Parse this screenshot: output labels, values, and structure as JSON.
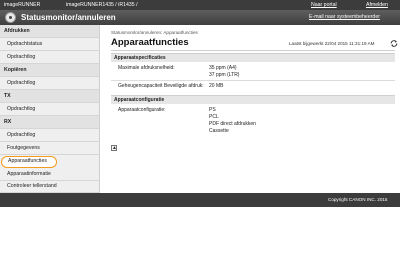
{
  "topbar": {
    "brand": "imageRUNNER",
    "model": "imageRUNNER1435 / iR1435 /",
    "portal_link": "Naar portal",
    "logout_link": "Afmelden"
  },
  "header": {
    "title": "Statusmonitor/annuleren",
    "mail_link": "E-mail naar systeembeheerder"
  },
  "sidebar": {
    "items": [
      {
        "label": "Afdrukken",
        "kind": "head"
      },
      {
        "label": "Opdrachtstatus",
        "kind": "link"
      },
      {
        "label": "Opdrachtlog",
        "kind": "link"
      },
      {
        "label": "Kopiëren",
        "kind": "head"
      },
      {
        "label": "Opdrachtlog",
        "kind": "link"
      },
      {
        "label": "TX",
        "kind": "head"
      },
      {
        "label": "Opdrachtlog",
        "kind": "link"
      },
      {
        "label": "RX",
        "kind": "head"
      },
      {
        "label": "Opdrachtlog",
        "kind": "link"
      },
      {
        "label": "Foutgegevens",
        "kind": "link"
      },
      {
        "label": "Apparaatfuncties",
        "kind": "selected"
      },
      {
        "label": "Apparaatinformatie",
        "kind": "link"
      },
      {
        "label": "Controleer tellerstand",
        "kind": "link"
      }
    ]
  },
  "main": {
    "breadcrumb": "Statusmonitor/annuleren: Apparaatfuncties",
    "title": "Apparaatfuncties",
    "last_updated": "Laatst bijgewerkt 22/04 2015 11:31:19 AM",
    "sections": [
      {
        "title": "Apparaatspecificaties",
        "rows": [
          {
            "label": "Maximale afdruksnelheid:",
            "values": [
              "35 ppm (A4)",
              "37 ppm (LTR)"
            ]
          },
          {
            "label": "Geheugencapaciteit Beveiligde afdruk:",
            "values": [
              "20 MB"
            ]
          }
        ]
      },
      {
        "title": "Apparaatconfiguratie",
        "rows": [
          {
            "label": "Apparaatconfiguratie:",
            "values": [
              "PS",
              "PCL",
              "PDF direct afdrukken",
              "Cassette"
            ]
          }
        ]
      }
    ]
  },
  "footer": {
    "copyright": "Copyright CANON INC. 2015"
  },
  "icons": {
    "refresh": "refresh-icon",
    "logo": "canon-logo-icon",
    "to_top": "to-top-icon"
  },
  "colors": {
    "selected_outline": "#f39b1f",
    "bar_dark": "#3c3c3c"
  }
}
